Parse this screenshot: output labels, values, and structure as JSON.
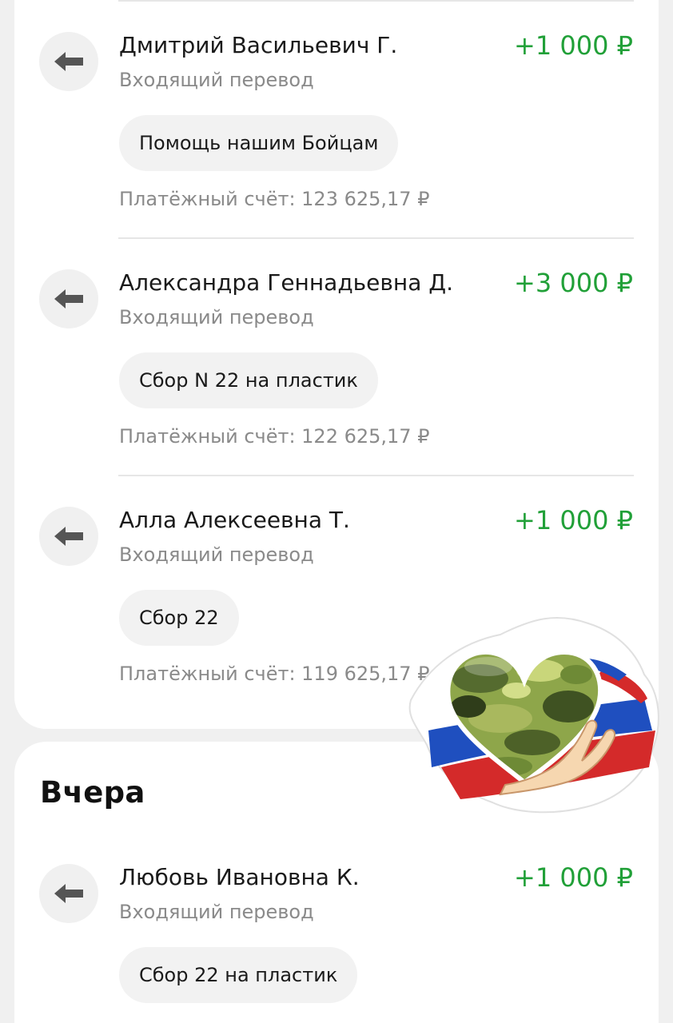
{
  "transactions_today": [
    {
      "name": "Дмитрий Васильевич Г.",
      "type": "Входящий перевод",
      "amount": "+1 000 ₽",
      "message": "Помощь нашим Бойцам",
      "balance": "Платёжный счёт: 123 625,17 ₽",
      "icon": "arrow-left-icon"
    },
    {
      "name": "Александра Геннадьевна Д.",
      "type": "Входящий перевод",
      "amount": "+3 000 ₽",
      "message": "Сбор N 22 на пластик",
      "balance": "Платёжный счёт: 122 625,17 ₽",
      "icon": "arrow-left-icon"
    },
    {
      "name": "Алла Алексеевна Т.",
      "type": "Входящий перевод",
      "amount": "+1 000 ₽",
      "message": "Сбор 22",
      "balance": "Платёжный счёт: 119 625,17 ₽",
      "icon": "arrow-left-icon"
    }
  ],
  "section_yesterday": {
    "title": "Вчера"
  },
  "transactions_yesterday": [
    {
      "name": "Любовь Ивановна К.",
      "type": "Входящий перевод",
      "amount": "+1 000 ₽",
      "message": "Сбор 22 на пластик",
      "icon": "arrow-left-icon"
    }
  ],
  "colors": {
    "amount_positive": "#21a038",
    "background": "#f0f0f0",
    "card": "#ffffff",
    "secondary_text": "#8a8a8a"
  },
  "sticker": {
    "icon": "camouflage-heart-in-hand-sticker"
  }
}
